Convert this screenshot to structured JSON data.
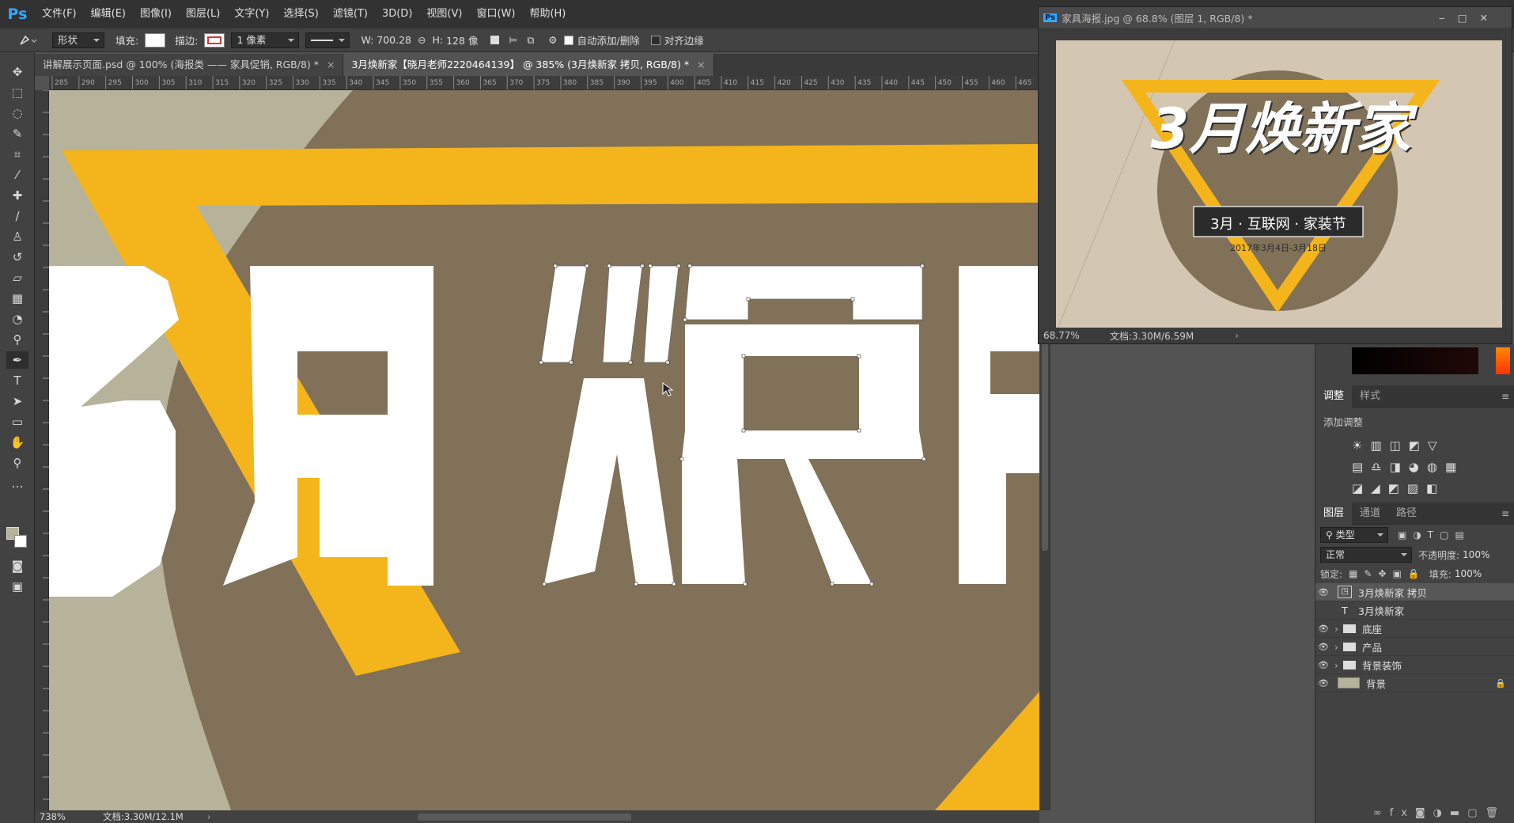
{
  "app": {
    "logo": "Ps"
  },
  "menu": [
    "文件(F)",
    "编辑(E)",
    "图像(I)",
    "图层(L)",
    "文字(Y)",
    "选择(S)",
    "滤镜(T)",
    "3D(D)",
    "视图(V)",
    "窗口(W)",
    "帮助(H)"
  ],
  "options": {
    "shape_mode": "形状",
    "fill_label": "填充:",
    "stroke_label": "描边:",
    "stroke_width": "1 像素",
    "w_label": "W:",
    "w_value": "700.28",
    "h_label": "H:",
    "h_value": "128 像",
    "auto_add_delete": "自动添加/删除",
    "align_edges": "对齐边缘"
  },
  "tabs": [
    {
      "label": "讲解展示页面.psd @ 100% (海报类 —— 家具促销, RGB/8) *",
      "active": false
    },
    {
      "label": "3月焕新家【晓月老师2220464139】 @ 385% (3月焕新家 拷贝, RGB/8) *",
      "active": true
    }
  ],
  "ruler_ticks": [
    "285",
    "290",
    "295",
    "300",
    "305",
    "310",
    "315",
    "320",
    "325",
    "330",
    "335",
    "340",
    "345",
    "350",
    "355",
    "360",
    "365",
    "370",
    "375",
    "380",
    "385",
    "390",
    "395",
    "400",
    "405",
    "410",
    "415",
    "420",
    "425",
    "430",
    "435",
    "440",
    "445",
    "450",
    "455",
    "460",
    "465"
  ],
  "canvas": {
    "text": "3月焕新",
    "colors": {
      "bg": "#807158",
      "left": "#b6b39a",
      "accent": "#f4b41c",
      "glyph": "#ffffff"
    }
  },
  "status": {
    "zoom": "738%",
    "doc": "文档:3.30M/12.1M"
  },
  "nav": {
    "title": "家具海报.jpg @ 68.8% (图层 1, RGB/8) *",
    "poster_title": "3月焕新家",
    "banner": "3月 · 互联网 · 家装节",
    "date": "2017年3月4日-3月18日",
    "zoom": "68.77%",
    "doc": "文档:3.30M/6.59M"
  },
  "adjust": {
    "tabs": [
      "调整",
      "样式"
    ],
    "add_label": "添加调整"
  },
  "layers": {
    "tabs": [
      "图层",
      "通道",
      "路径"
    ],
    "filter_label": "类型",
    "blend": "正常",
    "opacity_label": "不透明度:",
    "opacity": "100%",
    "lock_label": "锁定:",
    "fill_label": "填充:",
    "fill": "100%",
    "items": [
      {
        "name": "3月焕新家 拷贝",
        "kind": "shape",
        "visible": true,
        "selected": true
      },
      {
        "name": "3月焕新家",
        "kind": "text",
        "visible": false,
        "selected": false
      },
      {
        "name": "底座",
        "kind": "group",
        "visible": true,
        "selected": false
      },
      {
        "name": "产品",
        "kind": "group",
        "visible": true,
        "selected": false
      },
      {
        "name": "背景装饰",
        "kind": "group",
        "visible": true,
        "selected": false
      },
      {
        "name": "背景",
        "kind": "bg",
        "visible": true,
        "selected": false
      }
    ]
  }
}
